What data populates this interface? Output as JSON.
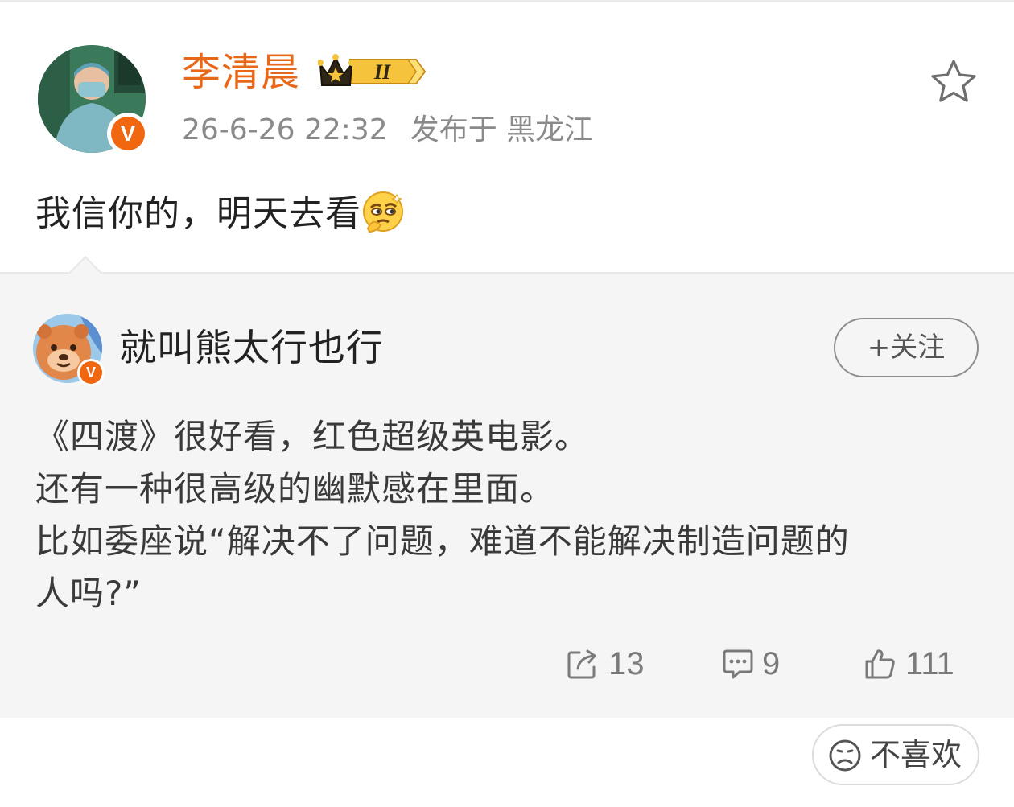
{
  "post": {
    "author": "李清晨",
    "level_badge": "II",
    "time": "26-6-26 22:32",
    "location": "发布于 黑龙江",
    "text": "我信你的，明天去看",
    "emoji_icon": "thinking-emoji-icon"
  },
  "quoted": {
    "author": "就叫熊太行也行",
    "follow_label": "+关注",
    "lines": [
      "《四渡》很好看，红色超级英电影。",
      "还有一种很高级的幽默感在里面。",
      "比如委座说“解决不了问题，难道不能解决制造问题的",
      "人吗?”"
    ],
    "stats": {
      "reposts": "13",
      "comments": "9",
      "likes": "111"
    }
  },
  "actions": {
    "dislike_label": "不喜欢"
  },
  "colors": {
    "author_orange": "#e8681a",
    "verified_orange": "#f0670f",
    "quote_bg": "#f5f5f5",
    "meta_gray": "#8a8a8a"
  }
}
